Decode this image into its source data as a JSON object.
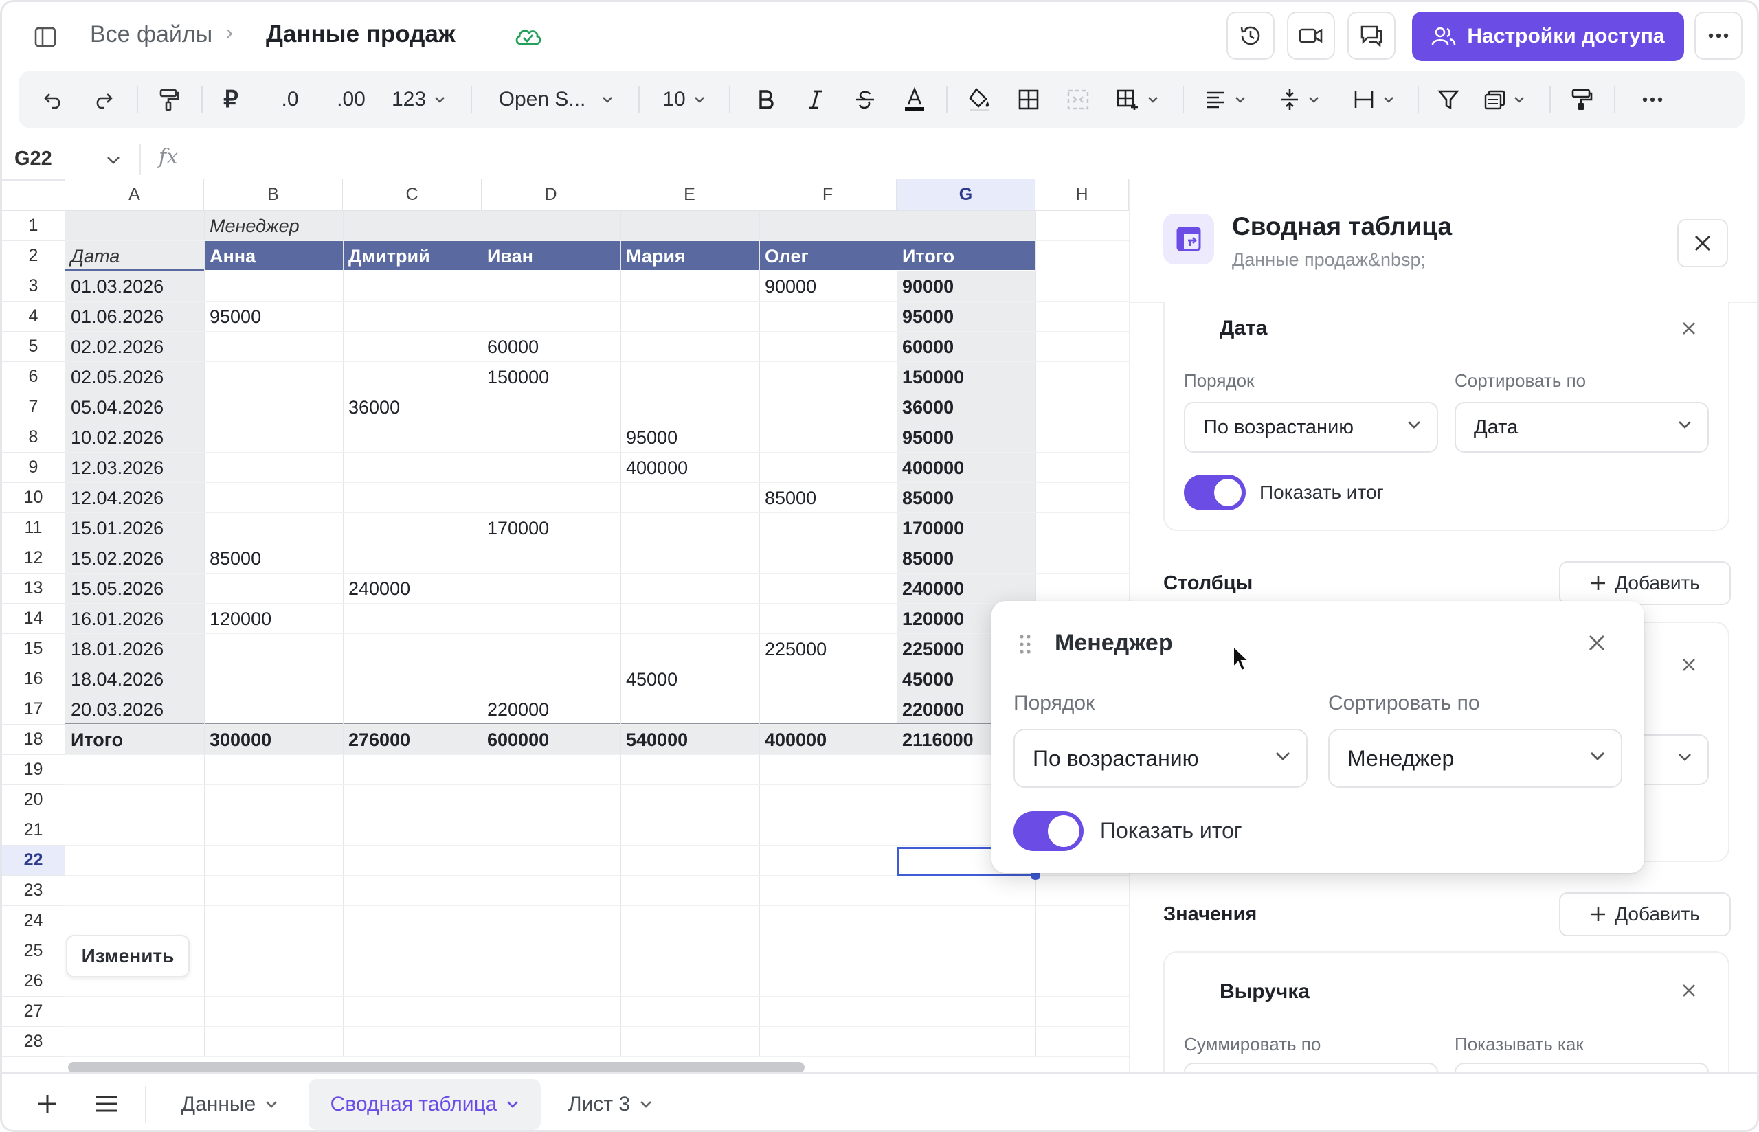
{
  "header": {
    "breadcrumb_root": "Все файлы",
    "breadcrumb_sep": "›",
    "file_title": "Данные продаж",
    "share_label": "Настройки доступа"
  },
  "toolbar": {
    "currency": "₽",
    "dec_less": ".0",
    "dec_more": ".00",
    "number_format": "123",
    "font_name": "Open S...",
    "font_size": "10"
  },
  "formula_bar": {
    "cell_ref": "G22",
    "fx_label": "fx"
  },
  "grid": {
    "columns": [
      "A",
      "B",
      "C",
      "D",
      "E",
      "F",
      "G",
      "H"
    ],
    "rows": [
      "1",
      "2",
      "3",
      "4",
      "5",
      "6",
      "7",
      "8",
      "9",
      "10",
      "11",
      "12",
      "13",
      "14",
      "15",
      "16",
      "17",
      "18",
      "19",
      "20",
      "21",
      "22",
      "23",
      "24",
      "25",
      "26",
      "27",
      "28"
    ],
    "selected_col": "G",
    "selected_row": "22",
    "pivot": {
      "manager_label": "Менеджер",
      "date_label": "Дата",
      "headers": [
        "Анна",
        "Дмитрий",
        "Иван",
        "Мария",
        "Олег",
        "Итого"
      ],
      "data_rows": [
        [
          "01.03.2026",
          "",
          "",
          "",
          "",
          "90000",
          "90000"
        ],
        [
          "01.06.2026",
          "95000",
          "",
          "",
          "",
          "",
          "95000"
        ],
        [
          "02.02.2026",
          "",
          "",
          "60000",
          "",
          "",
          "60000"
        ],
        [
          "02.05.2026",
          "",
          "",
          "150000",
          "",
          "",
          "150000"
        ],
        [
          "05.04.2026",
          "",
          "36000",
          "",
          "",
          "",
          "36000"
        ],
        [
          "10.02.2026",
          "",
          "",
          "",
          "95000",
          "",
          "95000"
        ],
        [
          "12.03.2026",
          "",
          "",
          "",
          "400000",
          "",
          "400000"
        ],
        [
          "12.04.2026",
          "",
          "",
          "",
          "",
          "85000",
          "85000"
        ],
        [
          "15.01.2026",
          "",
          "",
          "170000",
          "",
          "",
          "170000"
        ],
        [
          "15.02.2026",
          "85000",
          "",
          "",
          "",
          "",
          "85000"
        ],
        [
          "15.05.2026",
          "",
          "240000",
          "",
          "",
          "",
          "240000"
        ],
        [
          "16.01.2026",
          "120000",
          "",
          "",
          "",
          "",
          "120000"
        ],
        [
          "18.01.2026",
          "",
          "",
          "",
          "",
          "225000",
          "225000"
        ],
        [
          "18.04.2026",
          "",
          "",
          "",
          "45000",
          "",
          "45000"
        ],
        [
          "20.03.2026",
          "",
          "",
          "220000",
          "",
          "",
          "220000"
        ]
      ],
      "total_row": [
        "Итого",
        "300000",
        "276000",
        "600000",
        "540000",
        "400000",
        "2116000"
      ]
    },
    "edit_button": "Изменить"
  },
  "panel": {
    "title": "Сводная таблица",
    "subtitle": "Данные продаж&nbsp;",
    "rows_card": {
      "field": "Дата",
      "order_label": "Порядок",
      "order_value": "По возрастанию",
      "sort_label": "Сортировать по",
      "sort_value": "Дата",
      "show_total": "Показать итог"
    },
    "columns_title": "Столбцы",
    "add_label": "Добавить",
    "values_title": "Значения",
    "values_card": {
      "field": "Выручка",
      "sum_label": "Суммировать по",
      "show_as_label": "Показывать как"
    }
  },
  "popup": {
    "field": "Менеджер",
    "order_label": "Порядок",
    "order_value": "По возрастанию",
    "sort_label": "Сортировать по",
    "sort_value": "Менеджер",
    "show_total": "Показать итог"
  },
  "sheets": [
    {
      "label": "Данные",
      "active": false
    },
    {
      "label": "Сводная таблица",
      "active": true
    },
    {
      "label": "Лист 3",
      "active": false
    }
  ],
  "colors": {
    "accent": "#6b4de6",
    "pivot_header": "#5a6aa0",
    "selection": "#3f5bd6"
  }
}
